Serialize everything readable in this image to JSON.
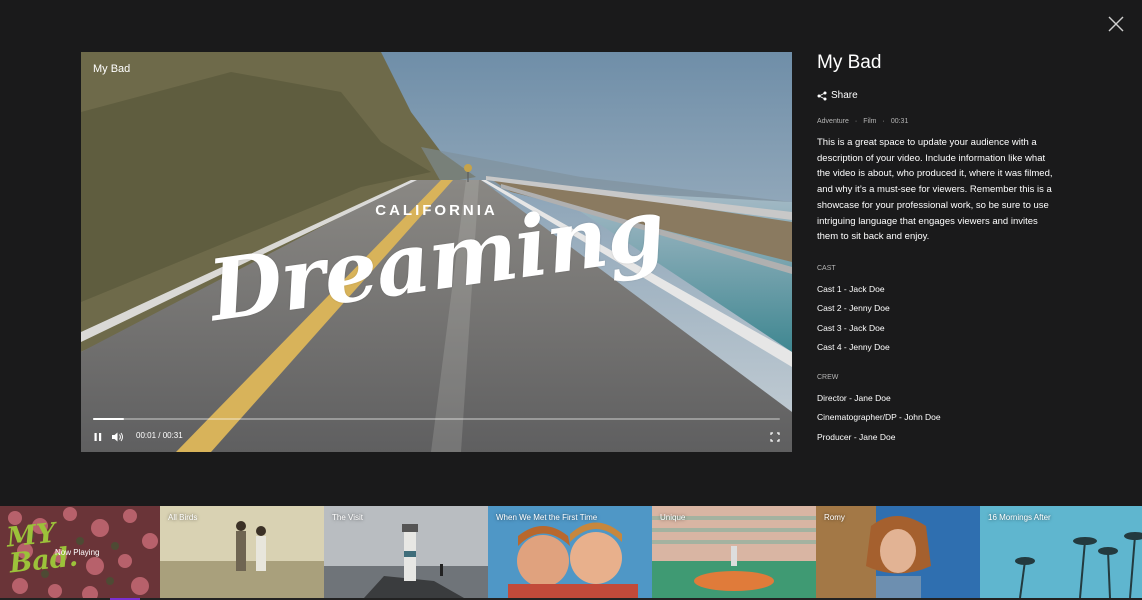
{
  "video": {
    "title": "My Bad",
    "overlay_line1": "CALIFORNIA",
    "overlay_line2": "Dreaming",
    "time": "00:01 / 00:31",
    "progress": 0.045
  },
  "info": {
    "title": "My Bad",
    "share_label": "Share",
    "genre": "Adventure",
    "category": "Film",
    "duration": "00:31",
    "separator": "·",
    "description": "This is a great space to update your audience with a description of your video. Include information like what the video is about, who produced it, where it was filmed, and why it’s a must-see for viewers. Remember this is a showcase for your professional work, so be sure to use intriguing language that engages viewers and invites them to sit back and enjoy.",
    "cast_label": "CAST",
    "cast": [
      "Cast 1 - Jack Doe",
      "Cast 2 - Jenny Doe",
      "Cast 3 - Jack Doe",
      "Cast 4 - Jenny Doe"
    ],
    "crew_label": "CREW",
    "crew": [
      "Director - Jane Doe",
      "Cinematographer/DP - John Doe",
      "Producer - Jane Doe"
    ]
  },
  "playlist": {
    "now_playing_logo_line1": "MY",
    "now_playing_logo_line2": "Bad.",
    "now_playing_label": "Now Playing",
    "items": [
      {
        "label": "All Birds"
      },
      {
        "label": "The Visit"
      },
      {
        "label": "When We Met the First Time"
      },
      {
        "label": "Unique"
      },
      {
        "label": "Romy"
      },
      {
        "label": "16 Mornings After"
      }
    ]
  },
  "colors": {
    "background": "#1a1a1b",
    "text": "#ffffff",
    "muted": "#b5b5b5",
    "logo_green": "#9cc23a",
    "accent": "#7a2fd1"
  },
  "icons": [
    "close-icon",
    "pause-icon",
    "volume-icon",
    "fullscreen-icon",
    "share-icon"
  ]
}
